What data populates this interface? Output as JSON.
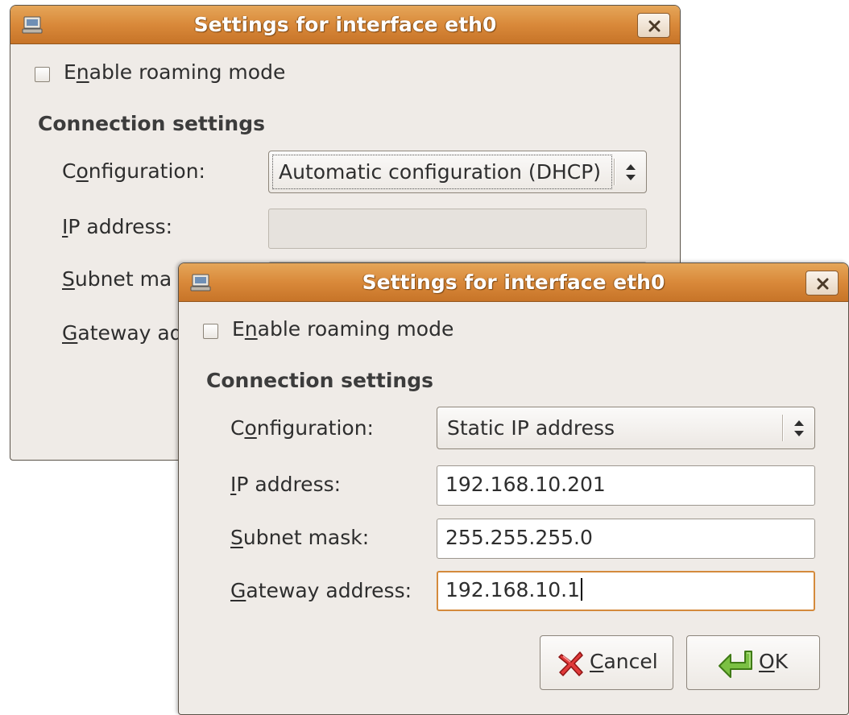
{
  "back_window": {
    "title": "Settings for interface eth0",
    "roaming": {
      "before": "E",
      "mnemonic": "n",
      "after": "able roaming mode",
      "checked": false
    },
    "section_title": "Connection settings",
    "configuration": {
      "before": "C",
      "mnemonic": "o",
      "after": "nfiguration:",
      "value": "Automatic configuration (DHCP)"
    },
    "ip_address": {
      "before": "",
      "mnemonic": "I",
      "after": "P address:",
      "value": ""
    },
    "subnet_mask": {
      "before": "",
      "mnemonic": "S",
      "after": "ubnet ma"
    },
    "gateway": {
      "before": "",
      "mnemonic": "G",
      "after": "ateway ad"
    }
  },
  "front_window": {
    "title": "Settings for interface eth0",
    "roaming": {
      "before": "E",
      "mnemonic": "n",
      "after": "able roaming mode",
      "checked": false
    },
    "section_title": "Connection settings",
    "configuration": {
      "before": "C",
      "mnemonic": "o",
      "after": "nfiguration:",
      "value": "Static IP address"
    },
    "ip_address": {
      "before": "",
      "mnemonic": "I",
      "after": "P address:",
      "value": "192.168.10.201"
    },
    "subnet_mask": {
      "before": "",
      "mnemonic": "S",
      "after": "ubnet mask:",
      "value": "255.255.255.0"
    },
    "gateway": {
      "before": "",
      "mnemonic": "G",
      "after": "ateway address:",
      "value": "192.168.10.1"
    },
    "buttons": {
      "cancel": {
        "mnemonic": "C",
        "after": "ancel"
      },
      "ok": {
        "mnemonic": "O",
        "after": "K"
      }
    }
  },
  "icons": {
    "window_icon": "network-interface-icon",
    "close": "close-icon",
    "combo_arrows": "updown-arrows-icon",
    "cancel": "cancel-x-icon",
    "ok": "ok-return-arrow-icon"
  },
  "colors": {
    "titlebar": "#d9893a",
    "window_bg": "#efebe7",
    "focus_border": "#d48a3c"
  }
}
